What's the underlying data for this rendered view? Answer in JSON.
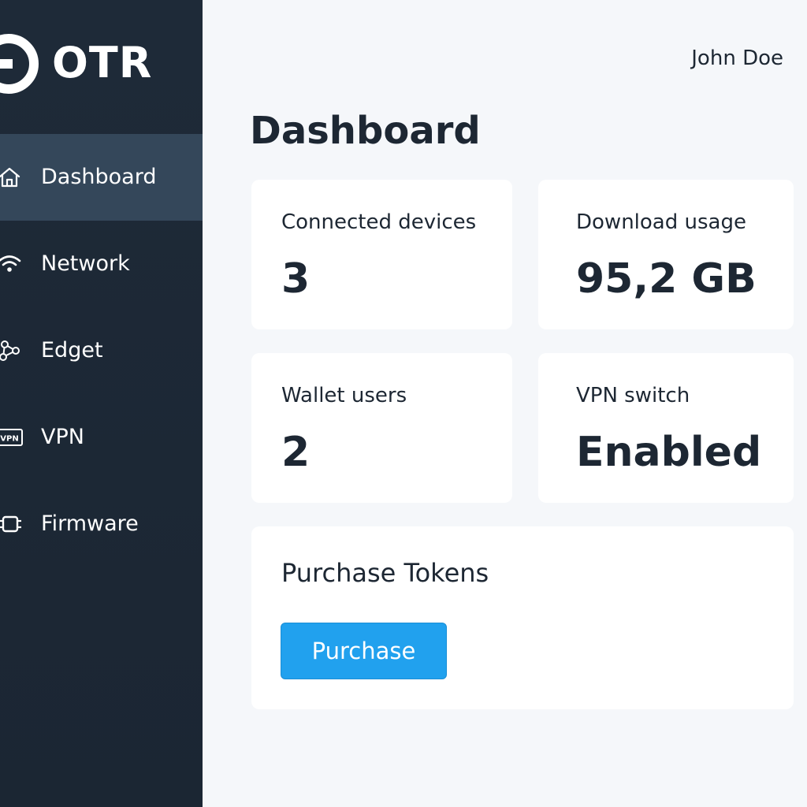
{
  "brand": {
    "name": "OTR",
    "logo_icon": "power-logo-icon"
  },
  "sidebar": {
    "items": [
      {
        "label": "Dashboard",
        "icon": "home-icon",
        "active": true
      },
      {
        "label": "Network",
        "icon": "wifi-icon",
        "active": false
      },
      {
        "label": "Edget",
        "icon": "nodes-icon",
        "active": false
      },
      {
        "label": "VPN",
        "icon": "vpn-icon",
        "active": false
      },
      {
        "label": "Firmware",
        "icon": "chip-icon",
        "active": false
      }
    ]
  },
  "header": {
    "user_name": "John Doe"
  },
  "main": {
    "title": "Dashboard",
    "stats": [
      {
        "label": "Connected devices",
        "value": "3"
      },
      {
        "label": "Download usage",
        "value": "95,2 GB"
      },
      {
        "label": "Wallet users",
        "value": "2"
      },
      {
        "label": "VPN switch",
        "value": "Enabled"
      }
    ],
    "purchase": {
      "title": "Purchase Tokens",
      "button_label": "Purchase"
    }
  },
  "colors": {
    "sidebar_bg": "#1e2a38",
    "sidebar_active": "#34475a",
    "accent": "#21a1ee",
    "text": "#1d2733",
    "page_bg": "#f5f7fa"
  }
}
